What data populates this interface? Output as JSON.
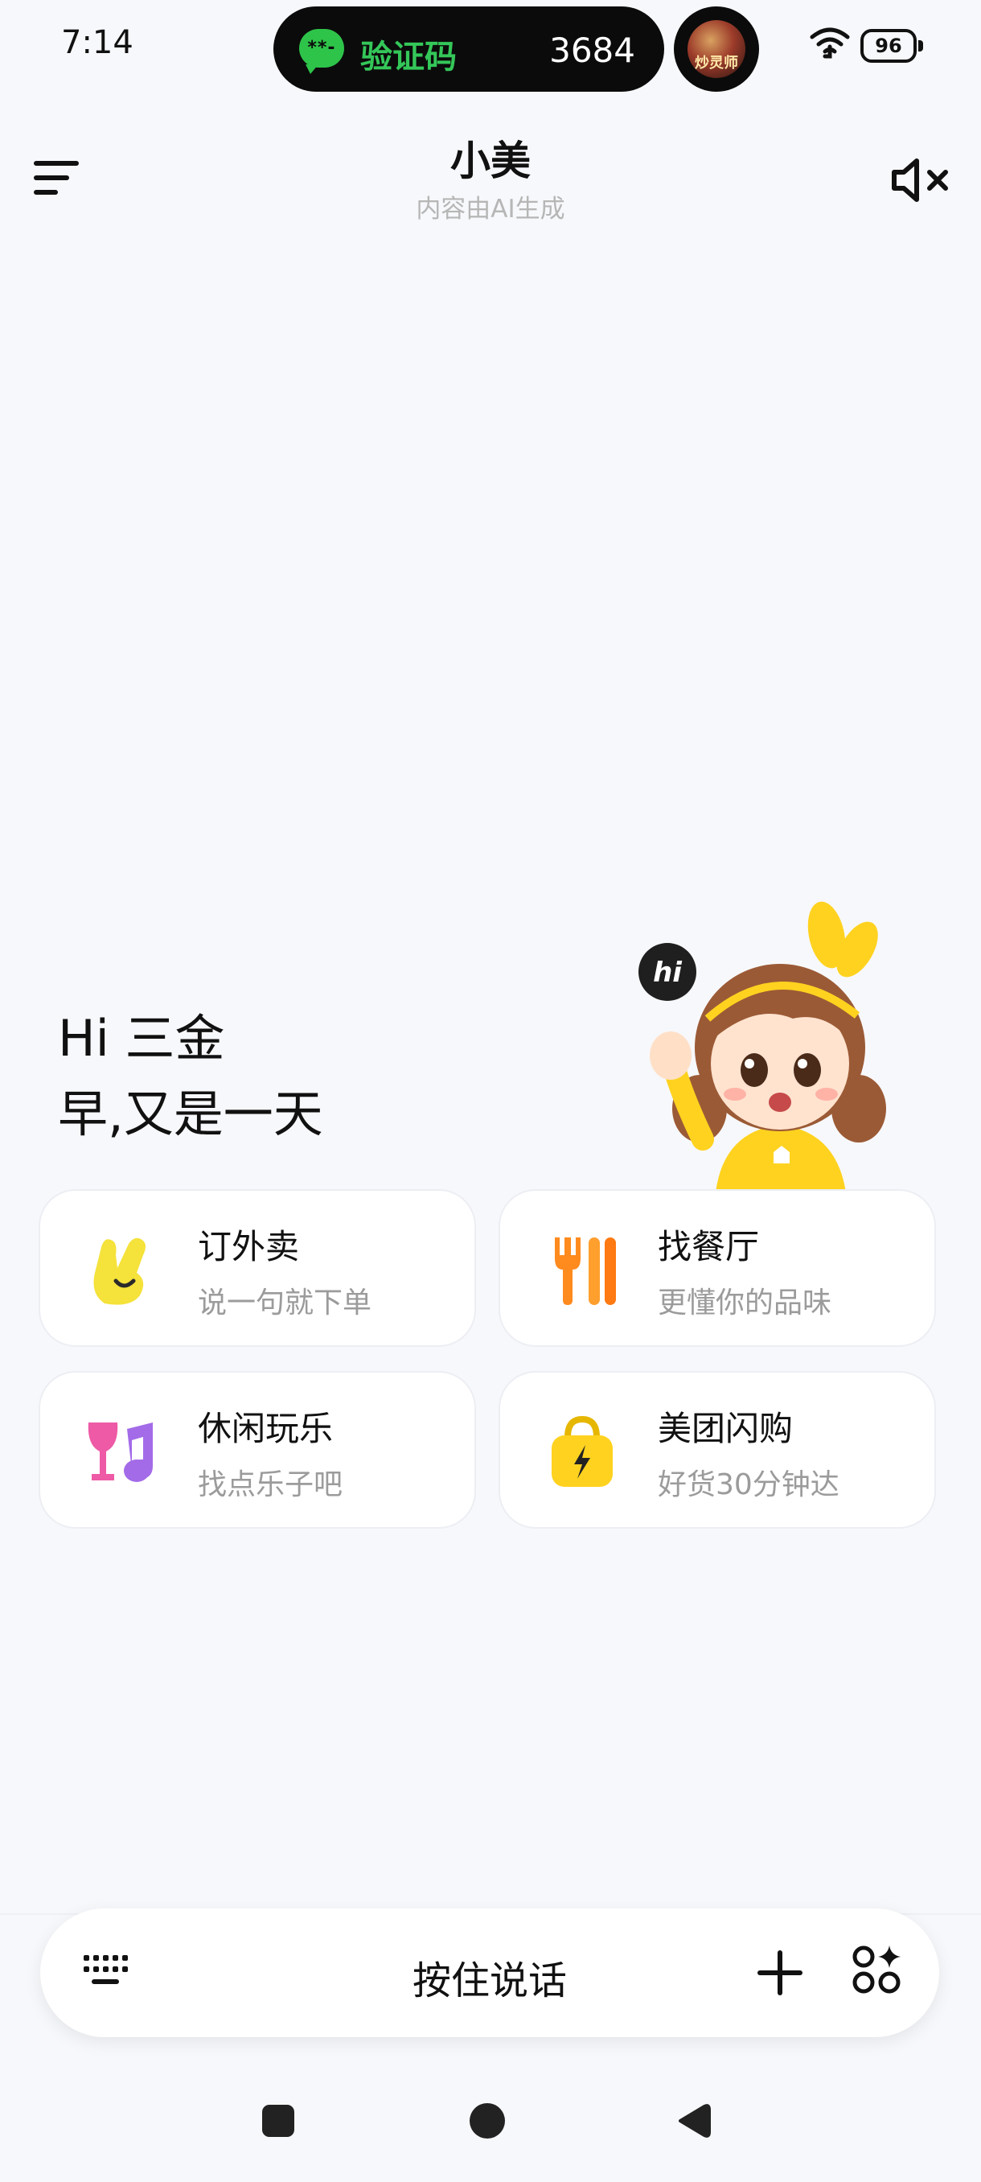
{
  "status_bar": {
    "time": "7:14",
    "notification_label": "验证码",
    "notification_code": "3684",
    "game_icon_text": "炒灵师",
    "battery": "96"
  },
  "header": {
    "title": "小美",
    "subtitle": "内容由AI生成"
  },
  "greeting": {
    "line1": "Hi 三金",
    "line2": "早,又是一天"
  },
  "mascot": {
    "bubble": "hi"
  },
  "cards": [
    {
      "title": "订外卖",
      "subtitle": "说一句就下单",
      "icon": "victory-hand-icon",
      "color": "#f5e23a"
    },
    {
      "title": "找餐厅",
      "subtitle": "更懂你的品味",
      "icon": "fork-knife-icon",
      "color": "#ff8a1e"
    },
    {
      "title": "休闲玩乐",
      "subtitle": "找点乐子吧",
      "icon": "glass-music-icon",
      "color": "#ee5aa6"
    },
    {
      "title": "美团闪购",
      "subtitle": "好货30分钟达",
      "icon": "shopping-bag-icon",
      "color": "#ffd21f"
    }
  ],
  "input_bar": {
    "label": "按住说话"
  },
  "colors": {
    "background": "#f7f8fb",
    "accent_green": "#34c759"
  }
}
